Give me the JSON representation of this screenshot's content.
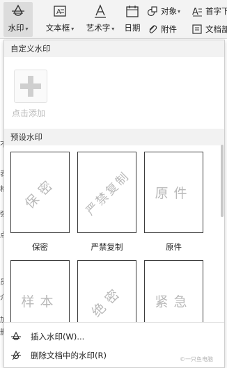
{
  "ribbon": {
    "watermark": "水印",
    "textbox": "文本框",
    "wordart": "艺术字",
    "date": "日期",
    "object": "对象",
    "attachment": "附件",
    "dropcap": "首字下",
    "docpart": "文档部"
  },
  "panel": {
    "custom_header": "自定义水印",
    "add_label": "点击添加",
    "preset_header": "预设水印",
    "presets": [
      {
        "text": "保密",
        "caption": "保密"
      },
      {
        "text": "严禁复制",
        "caption": "严禁复制"
      },
      {
        "text": "原件",
        "caption": "原件"
      },
      {
        "text": "样本",
        "caption": ""
      },
      {
        "text": "绝密",
        "caption": ""
      },
      {
        "text": "紧急",
        "caption": ""
      }
    ],
    "insert_label": "插入水印(W)...",
    "delete_label": "删除文档中的水印(R)"
  },
  "left_chars": [
    "不",
    "表",
    "格",
    "强",
    "点",
    "员",
    "介",
    "加",
    "删"
  ],
  "footer_watermark": "©一只鱼电脑",
  "colors": {
    "accent": "#d9534f",
    "tile_border": "#3c3c3c",
    "watermark_text": "#b9b9b9"
  }
}
